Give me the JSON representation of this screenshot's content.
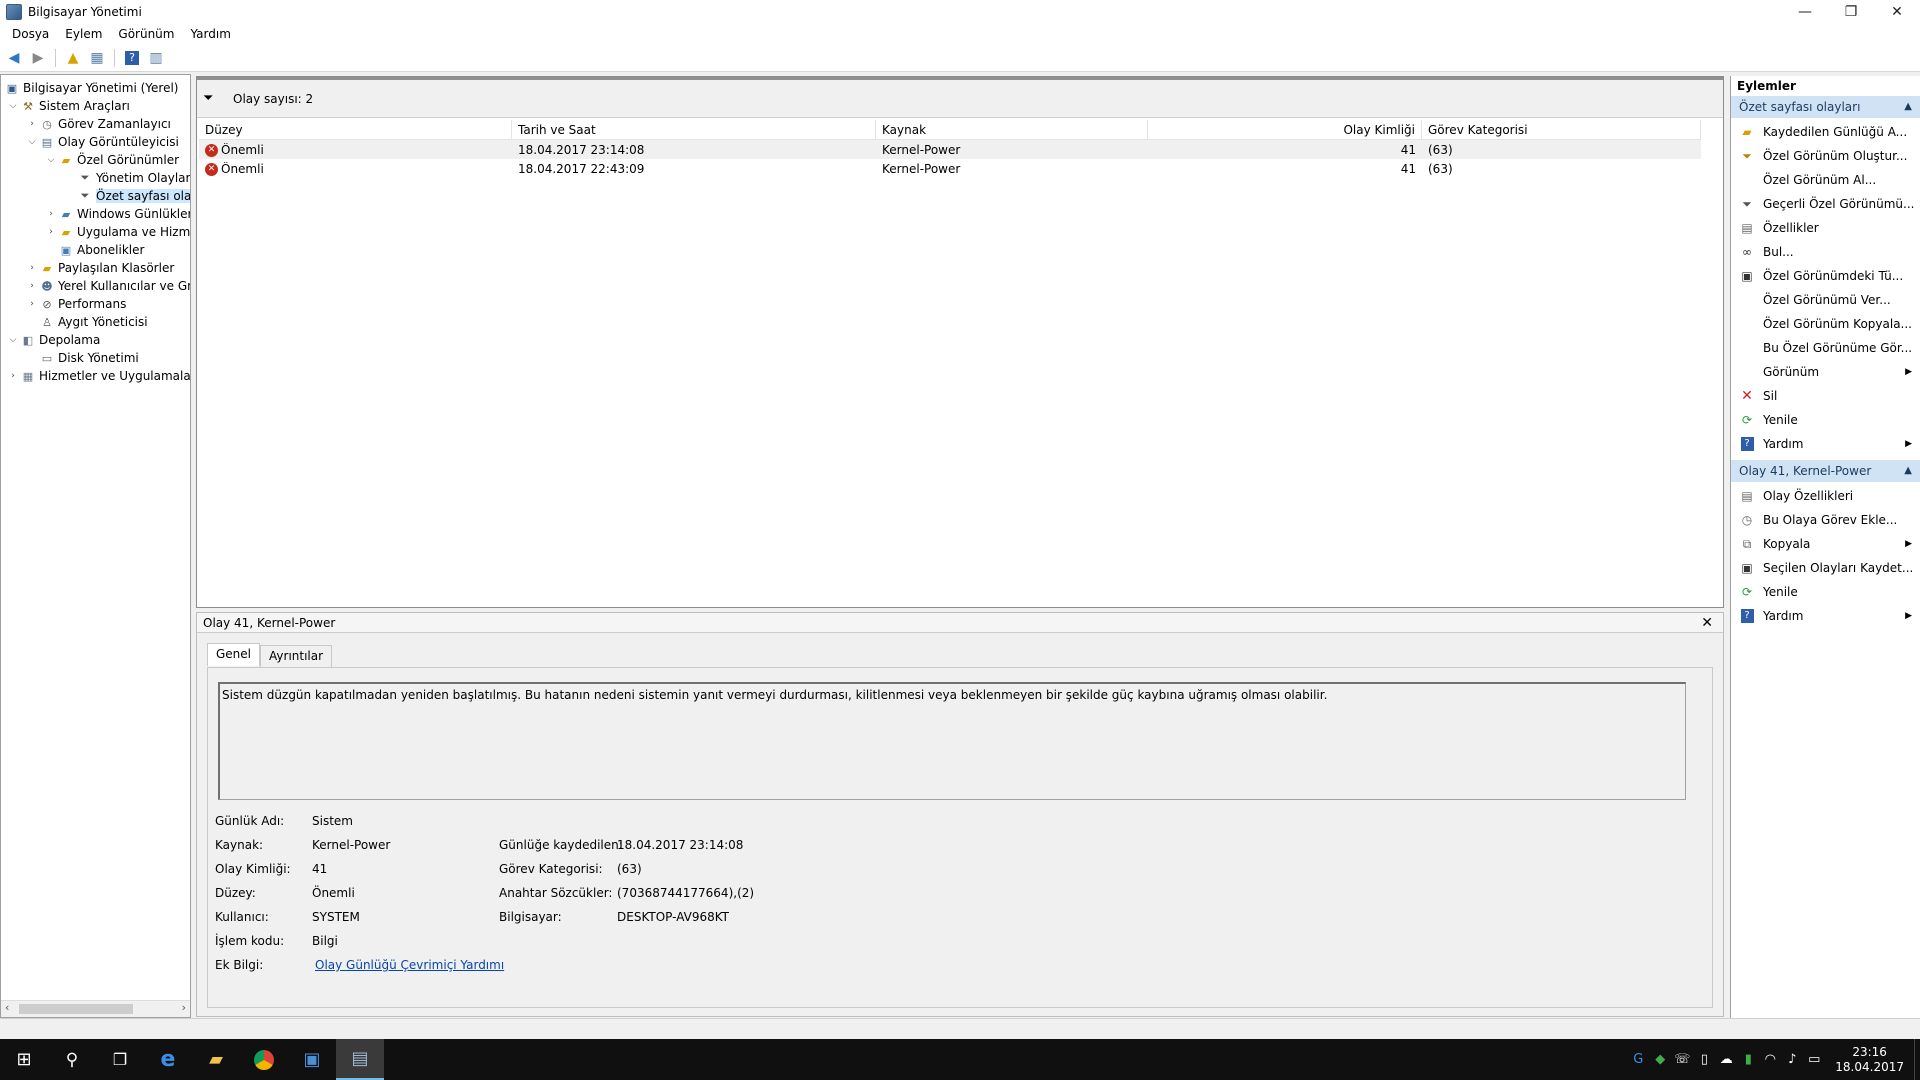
{
  "window": {
    "title": "Bilgisayar Yönetimi",
    "minimize": "—",
    "maximize": "❐",
    "close": "✕"
  },
  "menu": [
    "Dosya",
    "Eylem",
    "Görünüm",
    "Yardım"
  ],
  "tree": {
    "items": [
      {
        "label": "Bilgisayar Yönetimi (Yerel)"
      },
      {
        "label": "Sistem Araçları"
      },
      {
        "label": "Görev Zamanlayıcı"
      },
      {
        "label": "Olay Görüntüleyicisi"
      },
      {
        "label": "Özel Görünümler"
      },
      {
        "label": "Yönetim Olayları"
      },
      {
        "label": "Özet sayfası olay"
      },
      {
        "label": "Windows Günlükleri"
      },
      {
        "label": "Uygulama ve Hizme"
      },
      {
        "label": "Abonelikler"
      },
      {
        "label": "Paylaşılan Klasörler"
      },
      {
        "label": "Yerel Kullanıcılar ve Gru"
      },
      {
        "label": "Performans"
      },
      {
        "label": "Aygıt Yöneticisi"
      },
      {
        "label": "Depolama"
      },
      {
        "label": "Disk Yönetimi"
      },
      {
        "label": "Hizmetler ve Uygulamalar"
      }
    ]
  },
  "filter": {
    "text": "Olay sayısı: 2"
  },
  "grid": {
    "columns": [
      "Düzey",
      "Tarih ve Saat",
      "Kaynak",
      "Olay Kimliği",
      "Görev Kategorisi"
    ],
    "rows": [
      {
        "level": "Önemli",
        "datetime": "18.04.2017 23:14:08",
        "source": "Kernel-Power",
        "id": "41",
        "category": "(63)"
      },
      {
        "level": "Önemli",
        "datetime": "18.04.2017 22:43:09",
        "source": "Kernel-Power",
        "id": "41",
        "category": "(63)"
      }
    ]
  },
  "detail": {
    "title": "Olay 41, Kernel-Power",
    "tabs": [
      "Genel",
      "Ayrıntılar"
    ],
    "description": "Sistem düzgün kapatılmadan yeniden başlatılmış. Bu hatanın nedeni sistemin yanıt vermeyi durdurması, kilitlenmesi veya beklenmeyen bir şekilde güç kaybına uğramış olması olabilir.",
    "props": {
      "log_name_label": "Günlük Adı:",
      "log_name": "Sistem",
      "source_label": "Kaynak:",
      "source": "Kernel-Power",
      "logged_label": "Günlüğe kaydedilen:",
      "logged": "18.04.2017 23:14:08",
      "event_id_label": "Olay Kimliği:",
      "event_id": "41",
      "task_cat_label": "Görev Kategorisi:",
      "task_cat": "(63)",
      "level_label": "Düzey:",
      "level": "Önemli",
      "keywords_label": "Anahtar Sözcükler:",
      "keywords": "(70368744177664),(2)",
      "user_label": "Kullanıcı:",
      "user": "SYSTEM",
      "computer_label": "Bilgisayar:",
      "computer": "DESKTOP-AV968KT",
      "opcode_label": "İşlem kodu:",
      "opcode": "Bilgi",
      "more_label": "Ek Bilgi:",
      "more_link": "Olay Günlüğü Çevrimiçi Yardımı"
    }
  },
  "actions": {
    "header": "Eylemler",
    "section1": {
      "title": "Özet sayfası olayları",
      "items": [
        {
          "label": "Kaydedilen Günlüğü A...",
          "icon": "open-folder-icon"
        },
        {
          "label": "Özel Görünüm Oluştur...",
          "icon": "filter-icon"
        },
        {
          "label": "Özel Görünüm Al...",
          "icon": ""
        },
        {
          "label": "Geçerli Özel Görünümü...",
          "icon": "filter-icon"
        },
        {
          "label": "Özellikler",
          "icon": "properties-icon"
        },
        {
          "label": "Bul...",
          "icon": "binoculars-icon"
        },
        {
          "label": "Özel Görünümdeki Tü...",
          "icon": "save-icon"
        },
        {
          "label": "Özel Görünümü Ver...",
          "icon": ""
        },
        {
          "label": "Özel Görünüm Kopyala...",
          "icon": ""
        },
        {
          "label": "Bu Özel Görünüme Gör...",
          "icon": ""
        },
        {
          "label": "Görünüm",
          "icon": "",
          "submenu": true
        },
        {
          "label": "Sil",
          "icon": "delete-icon"
        },
        {
          "label": "Yenile",
          "icon": "refresh-icon"
        },
        {
          "label": "Yardım",
          "icon": "help-icon",
          "submenu": true
        }
      ]
    },
    "section2": {
      "title": "Olay 41, Kernel-Power",
      "items": [
        {
          "label": "Olay Özellikleri",
          "icon": "properties-icon"
        },
        {
          "label": "Bu Olaya Görev Ekle...",
          "icon": "task-icon"
        },
        {
          "label": "Kopyala",
          "icon": "copy-icon",
          "submenu": true
        },
        {
          "label": "Seçilen Olayları Kaydet...",
          "icon": "save-icon"
        },
        {
          "label": "Yenile",
          "icon": "refresh-icon"
        },
        {
          "label": "Yardım",
          "icon": "help-icon",
          "submenu": true
        }
      ]
    }
  },
  "taskbar": {
    "time": "23:16",
    "date": "18.04.2017"
  },
  "colors": {
    "accent": "#cfe3f5",
    "error": "#c42b1c",
    "selection": "#cce8ff",
    "link": "#0645ad"
  }
}
